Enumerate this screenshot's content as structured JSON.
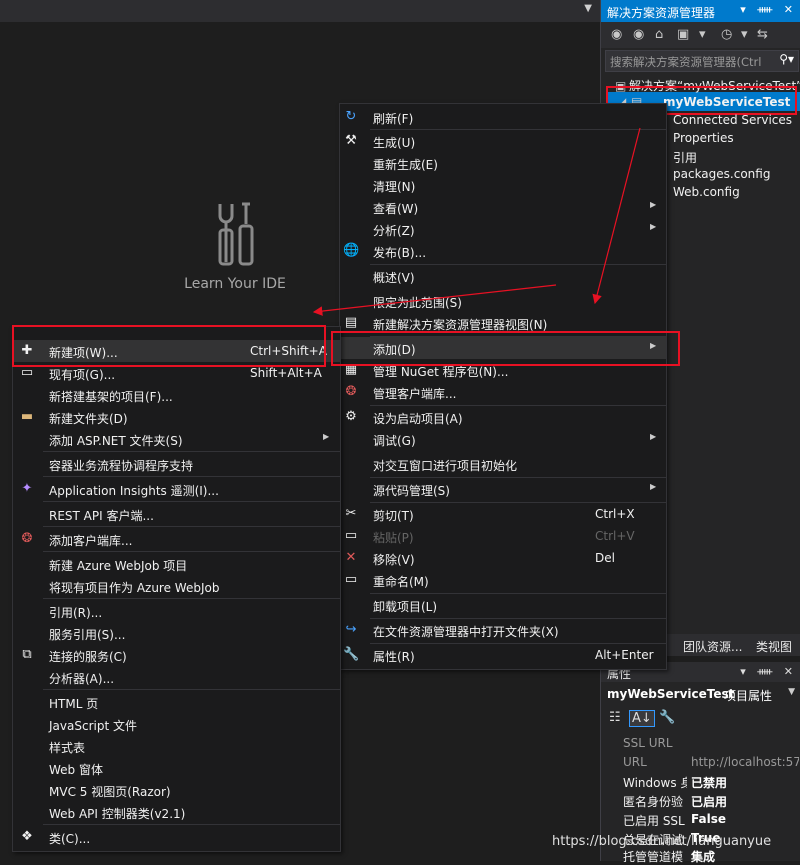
{
  "learn": {
    "label": "Learn Your IDE"
  },
  "solution_explorer": {
    "title": "解决方案资源管理器",
    "title_buttons": "▾ ᚔ ✕",
    "search_placeholder": "搜索解决方案资源管理器(Ctrl",
    "tree": [
      {
        "label": "解决方案“myWebServiceTest”("
      },
      {
        "label": "myWebServiceTest"
      },
      {
        "label": "Connected Services"
      },
      {
        "label": "Properties"
      },
      {
        "label": "引用"
      },
      {
        "label": "packages.config"
      },
      {
        "label": "Web.config"
      }
    ],
    "bottom_tabs": [
      "团队资源...",
      "类视图"
    ]
  },
  "properties": {
    "title": "属性",
    "object_name": "myWebServiceTest",
    "object_kind": "项目属性",
    "rows": [
      {
        "key": "SSL URL",
        "value": ""
      },
      {
        "key": "URL",
        "value": "http://localhost:5767"
      },
      {
        "key": "Windows 身",
        "value": "已禁用"
      },
      {
        "key": "匿名身份验",
        "value": "已启用"
      },
      {
        "key": "已启用 SSL",
        "value": "False"
      },
      {
        "key": "总是在调试",
        "value": "True"
      },
      {
        "key": "托管管道模",
        "value": "集成"
      }
    ]
  },
  "context_menu": {
    "items": [
      {
        "label": "刷新(F)",
        "icon": "refresh-icon"
      },
      {
        "label": "生成(U)",
        "icon": "build-icon"
      },
      {
        "label": "重新生成(E)"
      },
      {
        "label": "清理(N)"
      },
      {
        "label": "查看(W)",
        "arrow": "▶"
      },
      {
        "label": "分析(Z)",
        "arrow": "▶"
      },
      {
        "label": "发布(B)...",
        "icon": "globe-icon"
      },
      {
        "label": "概述(V)"
      },
      {
        "label": "限定为此范围(S)"
      },
      {
        "label": "新建解决方案资源管理器视图(N)",
        "icon": "new-view-icon"
      },
      {
        "label": "添加(D)",
        "arrow": "▶"
      },
      {
        "label": "管理 NuGet 程序包(N)...",
        "icon": "nuget-icon"
      },
      {
        "label": "管理客户端库...",
        "icon": "client-lib-icon"
      },
      {
        "label": "设为启动项目(A)",
        "icon": "gear-icon"
      },
      {
        "label": "调试(G)",
        "arrow": "▶"
      },
      {
        "label": "对交互窗口进行项目初始化"
      },
      {
        "label": "源代码管理(S)",
        "arrow": "▶"
      },
      {
        "label": "剪切(T)",
        "shortcut": "Ctrl+X",
        "icon": "scissors-icon"
      },
      {
        "label": "粘贴(P)",
        "shortcut": "Ctrl+V",
        "icon": "paste-icon"
      },
      {
        "label": "移除(V)",
        "shortcut": "Del",
        "icon": "remove-icon"
      },
      {
        "label": "重命名(M)",
        "icon": "rename-icon"
      },
      {
        "label": "卸载项目(L)"
      },
      {
        "label": "在文件资源管理器中打开文件夹(X)",
        "icon": "open-folder-icon"
      },
      {
        "label": "属性(R)",
        "shortcut": "Alt+Enter",
        "icon": "wrench-icon"
      }
    ]
  },
  "add_submenu": {
    "items": [
      {
        "label": "新建项(W)...",
        "shortcut": "Ctrl+Shift+A",
        "icon": "new-item-icon"
      },
      {
        "label": "现有项(G)...",
        "shortcut": "Shift+Alt+A",
        "icon": "existing-item-icon"
      },
      {
        "label": "新搭建基架的项目(F)..."
      },
      {
        "label": "新建文件夹(D)",
        "icon": "new-folder-icon"
      },
      {
        "label": "添加 ASP.NET 文件夹(S)",
        "arrow": "▶"
      },
      {
        "label": "容器业务流程协调程序支持"
      },
      {
        "label": "Application Insights 遥测(I)...",
        "icon": "insights-icon"
      },
      {
        "label": "REST API 客户端..."
      },
      {
        "label": "添加客户端库...",
        "icon": "client-lib-icon"
      },
      {
        "label": "新建 Azure WebJob 项目"
      },
      {
        "label": "将现有项目作为 Azure WebJob"
      },
      {
        "label": "引用(R)..."
      },
      {
        "label": "服务引用(S)..."
      },
      {
        "label": "连接的服务(C)",
        "icon": "connected-service-icon"
      },
      {
        "label": "分析器(A)..."
      },
      {
        "label": "HTML 页"
      },
      {
        "label": "JavaScript 文件"
      },
      {
        "label": "样式表"
      },
      {
        "label": "Web 窗体"
      },
      {
        "label": "MVC 5 视图页(Razor)"
      },
      {
        "label": "Web API 控制器类(v2.1)"
      },
      {
        "label": "类(C)...",
        "icon": "class-icon"
      }
    ]
  },
  "watermark": "https://blog.csdn.net/lianguanyue",
  "colors": {
    "accent": "#007acc",
    "annotation": "#e81123",
    "menu_bg": "#1b1b1c"
  }
}
